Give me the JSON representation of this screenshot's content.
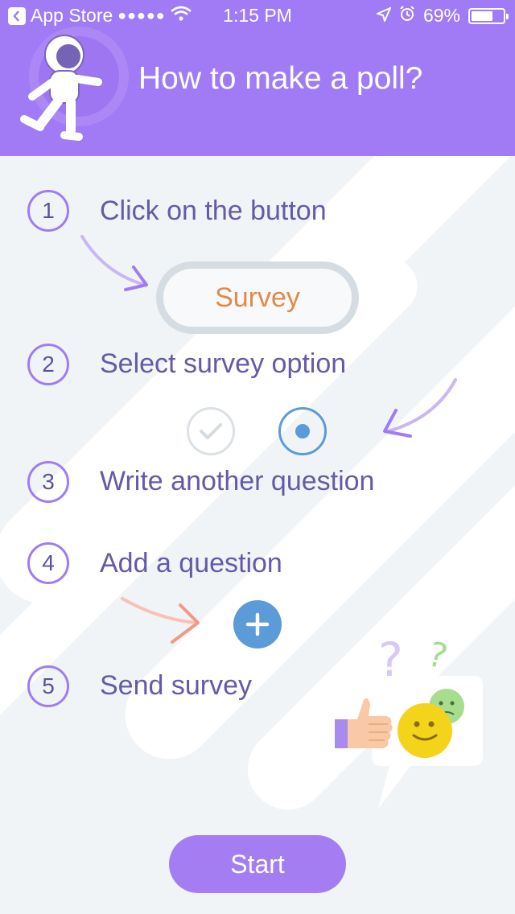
{
  "status_bar": {
    "back_app": "App Store",
    "signal": "●●●●●",
    "time": "1:15 PM",
    "battery": "69%",
    "battery_level": 0.69
  },
  "header": {
    "title": "How to make a poll?"
  },
  "steps": [
    {
      "number": "1",
      "label": "Click on the button"
    },
    {
      "number": "2",
      "label": "Select survey option"
    },
    {
      "number": "3",
      "label": "Write another question"
    },
    {
      "number": "4",
      "label": "Add a question"
    },
    {
      "number": "5",
      "label": "Send survey"
    }
  ],
  "survey_button": {
    "label": "Survey"
  },
  "start_button": {
    "label": "Start"
  },
  "colors": {
    "primary": "#a07bf5",
    "step_text": "#6659a8",
    "survey_text": "#e48a47",
    "accent_blue": "#5a9bd8"
  }
}
